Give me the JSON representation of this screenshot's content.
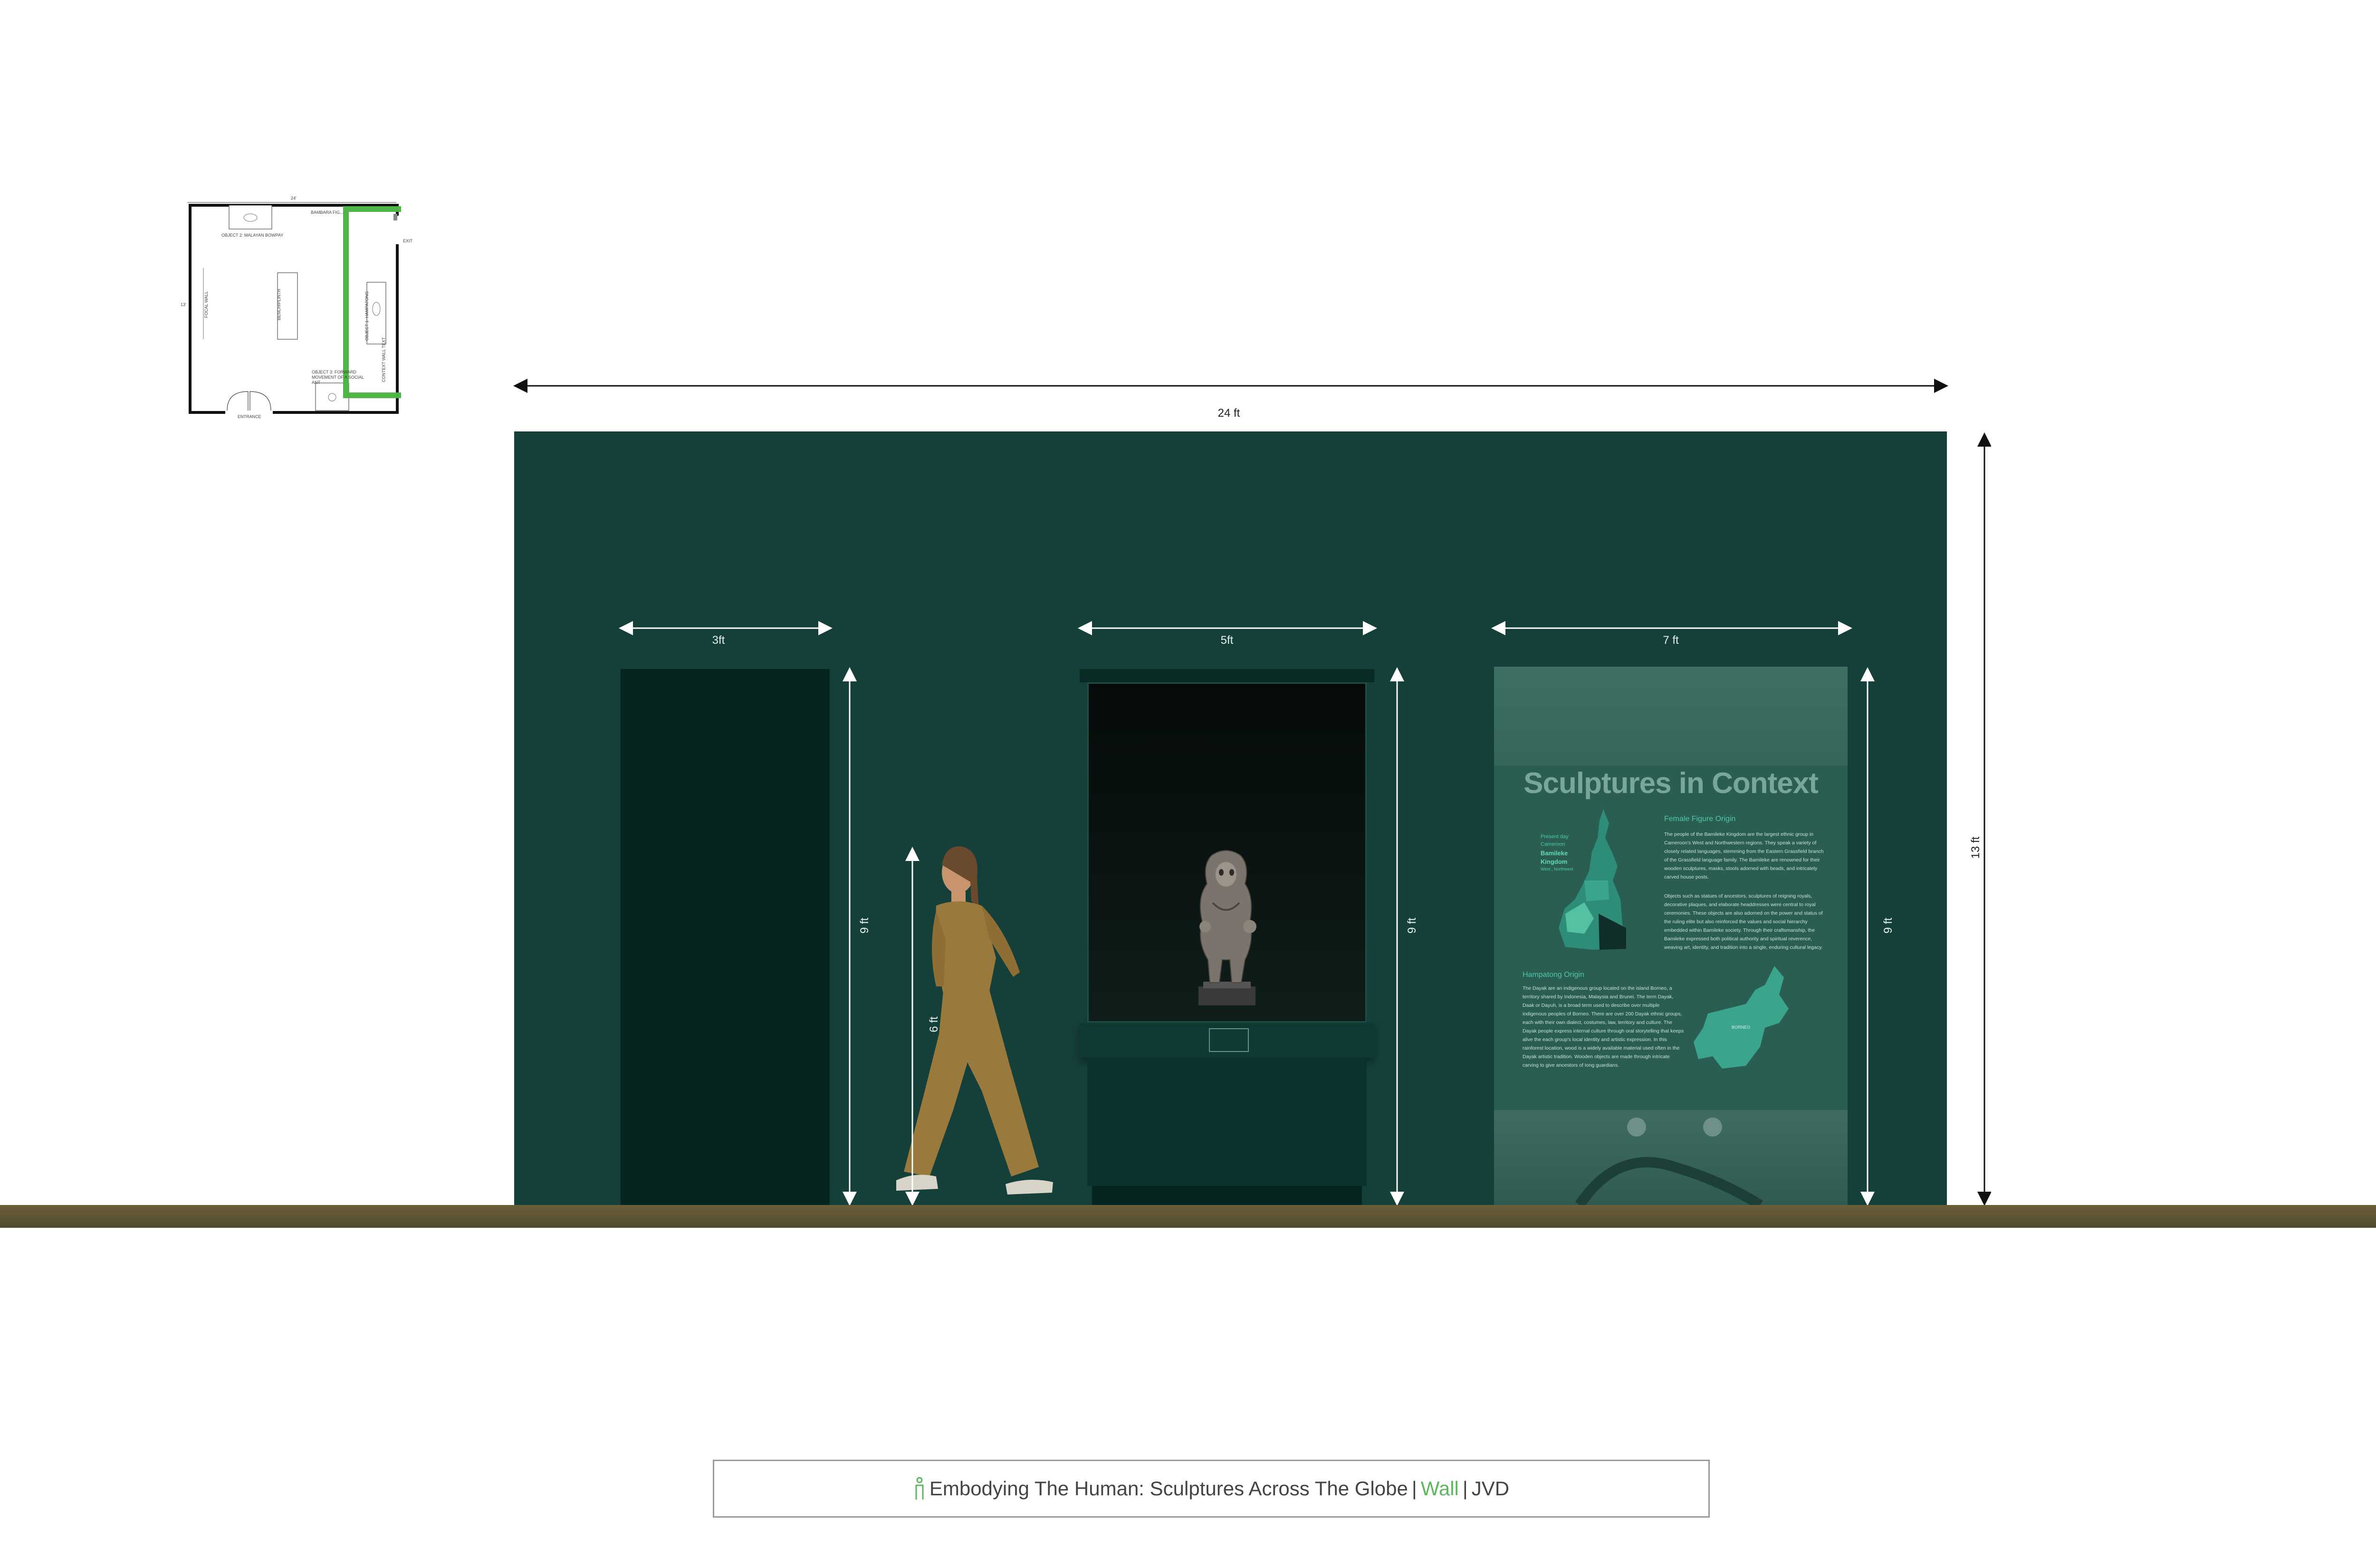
{
  "dimensions": {
    "overall_width": "24 ft",
    "overall_height": "13 ft",
    "door_width": "3ft",
    "door_height": "9 ft",
    "person_height": "6 ft",
    "case_width": "5ft",
    "case_height": "9 ft",
    "panel_width": "7 ft",
    "panel_height": "9 ft"
  },
  "panel": {
    "title": "Sculptures in Context",
    "section1_heading": "Female Figure Origin",
    "section1_para1": "The people of the Bamileke Kingdom are the largest ethnic group in Cameroon's West and Northwestern regions. They speak a variety of closely related languages, stemming from the Eastern Grassfield branch of the Grassfield language family. The Bamileke are renowned for their wooden sculptures, masks, stools adorned with beads, and intricately carved house posts.",
    "section1_para2": "Objects such as statues of ancestors, sculptures of reigning royals, decorative plaques, and elaborate headdresses were central to royal ceremonies. These objects are also adorned on the power and status of the ruling elite but also reinforced the values and social hierarchy embedded within Bamileke society. Through their craftsmanship, the Bamileke expressed both political authority and spiritual reverence, weaving art, identity, and tradition into a single, enduring cultural legacy.",
    "map1_label_small": "Present day Cameroon",
    "map1_label_big": "Bamileke Kingdom",
    "map1_label_sub": "West , Northwest",
    "section2_heading": "Hampatong Origin",
    "section2_para": "The Dayak are an indigenous group located on the island Borneo, a territory shared by Indonesia, Malaysia and Brunei. The term Dayak, Daak or Dayuh, is a broad term used to describe over multiple indigenous peoples of Borneo. There are over 200 Dayak ethnic groups, each with their own dialect, costumes, law, territory and culture. The Dayak people express internal culture through oral storytelling that keeps alive the each group's local identity and artistic expression. In this rainforest location, wood is a widely available material used often in the Dayak artistic tradition. Wooden objects are made through intricate carving to give ancestors of Iong guardians.",
    "map2_label": "BORNEO"
  },
  "floorplan": {
    "label_top_right": "BAMBARA FIG...",
    "label_object2": "OBJECT 2: MALAYAN BOWPAY",
    "label_entrance": "ENTRANCE",
    "label_object3": "OBJECT 3: FORWARD MOVEMENT OF A SOCIAL ANT",
    "label_case": "OBJECT 1: HAMPATONG",
    "label_bench": "BENCH/PLINTH",
    "label_wall_text": "CONTEXT WALL TEXT",
    "label_left": "FOCAL WALL",
    "label_exit": "EXIT",
    "dim_top": "24'",
    "dim_left": "13'"
  },
  "title_block": {
    "exhibition": "Embodying The Human: Sculptures Across The Globe",
    "separator": "|",
    "view": "Wall",
    "author": "JVD"
  },
  "colors": {
    "wall": "#153f39",
    "floor": "#6b5f3a",
    "accent_green": "#5cb85c",
    "panel_teal": "#2b5e53",
    "highlight": "#4fb548"
  },
  "icons": {
    "person_icon": "person-icon",
    "sculpture": "sculpture-figure",
    "visitor": "visitor-silhouette"
  }
}
